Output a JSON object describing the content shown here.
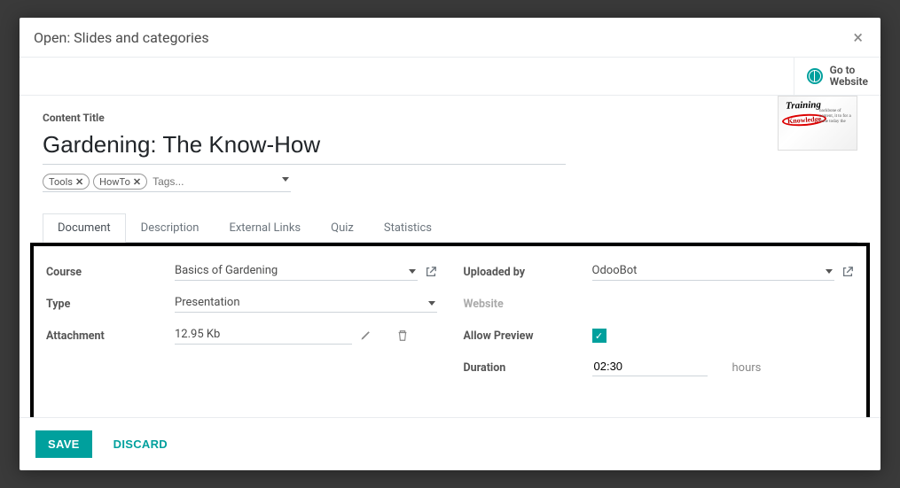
{
  "modal": {
    "title": "Open: Slides and categories",
    "go_to_website": "Go to\nWebsite"
  },
  "content": {
    "title_label": "Content Title",
    "title_value": "Gardening: The Know-How",
    "tags_placeholder": "Tags...",
    "tags": [
      "Tools",
      "HowTo"
    ],
    "thumb": {
      "line1": "Training",
      "line2": "Knowledge",
      "line3": "backbone of content, it to for a trade today the"
    }
  },
  "tabs": {
    "items": [
      "Document",
      "Description",
      "External Links",
      "Quiz",
      "Statistics"
    ],
    "active_index": 0
  },
  "form": {
    "left": {
      "course_label": "Course",
      "course_value": "Basics of Gardening",
      "type_label": "Type",
      "type_value": "Presentation",
      "attachment_label": "Attachment",
      "attachment_value": "12.95 Kb"
    },
    "right": {
      "uploaded_by_label": "Uploaded by",
      "uploaded_by_value": "OdooBot",
      "website_label": "Website",
      "allow_preview_label": "Allow Preview",
      "allow_preview_checked": true,
      "duration_label": "Duration",
      "duration_value": "02:30",
      "duration_unit": "hours"
    }
  },
  "footer": {
    "save": "SAVE",
    "discard": "DISCARD"
  }
}
